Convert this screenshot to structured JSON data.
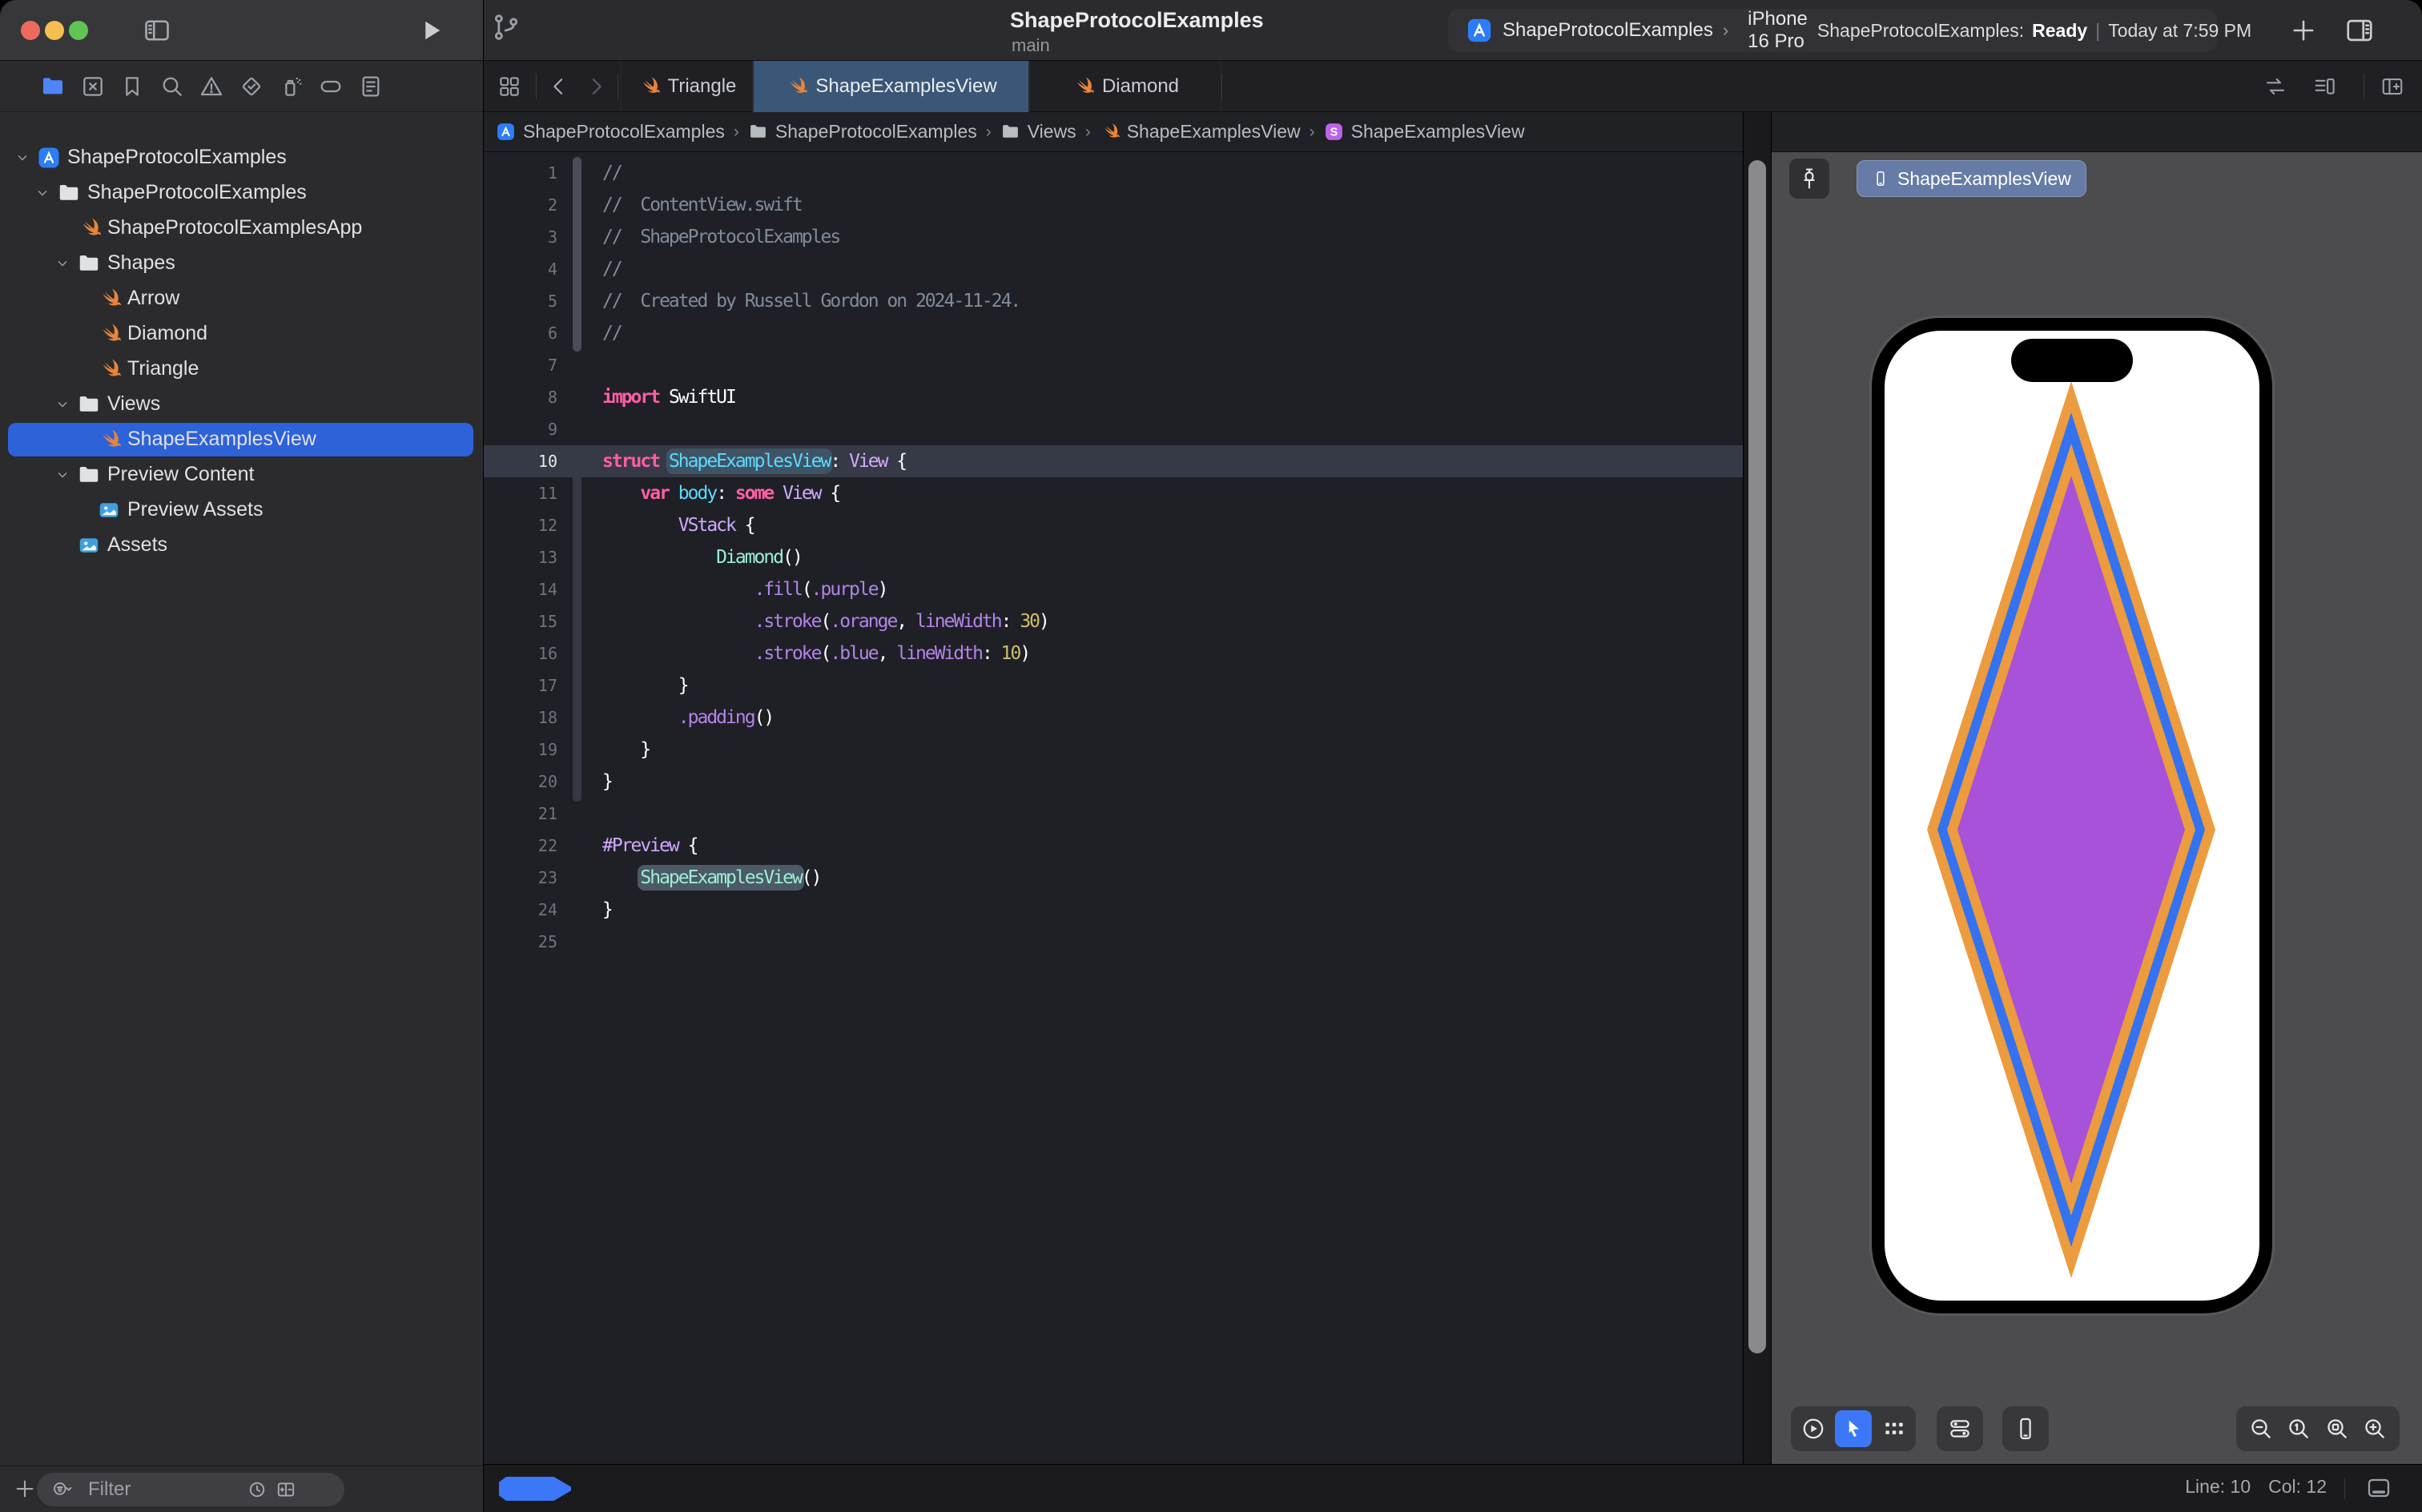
{
  "window": {
    "title": "ShapeProtocolExamples",
    "subtitle": "main"
  },
  "toolbar": {
    "scheme_app": "ShapeProtocolExamples",
    "sep": "›",
    "device": "iPhone 16 Pro",
    "status_app": "ShapeProtocolExamples:",
    "status_state": "Ready",
    "status_bar": "|",
    "status_time": "Today at 7:59 PM"
  },
  "tabs": [
    {
      "label": "Triangle",
      "icon": "swift",
      "active": false
    },
    {
      "label": "ShapeExamplesView",
      "icon": "swift",
      "active": true
    },
    {
      "label": "Diamond",
      "icon": "swift",
      "active": false
    }
  ],
  "breadcrumbs": [
    {
      "icon": "app",
      "label": "ShapeProtocolExamples"
    },
    {
      "icon": "folder",
      "label": "ShapeProtocolExamples"
    },
    {
      "icon": "folder",
      "label": "Views"
    },
    {
      "icon": "swift",
      "label": "ShapeExamplesView"
    },
    {
      "icon": "s-symbol",
      "label": "ShapeExamplesView"
    }
  ],
  "crumb_sep": "›",
  "sidebar": {
    "rail": [
      "folder",
      "grid-x",
      "bookmark",
      "search",
      "warning",
      "check-diamond",
      "spray",
      "tag",
      "report"
    ],
    "rail_active": 0,
    "tree": [
      {
        "label": "ShapeProtocolExamples",
        "icon": "app",
        "level": 0,
        "exp": true
      },
      {
        "label": "ShapeProtocolExamples",
        "icon": "folder",
        "level": 1,
        "exp": true
      },
      {
        "label": "ShapeProtocolExamplesApp",
        "icon": "swift",
        "level": 2
      },
      {
        "label": "Shapes",
        "icon": "folder",
        "level": 2,
        "exp": true
      },
      {
        "label": "Arrow",
        "icon": "swift",
        "level": 3
      },
      {
        "label": "Diamond",
        "icon": "swift",
        "level": 3
      },
      {
        "label": "Triangle",
        "icon": "swift",
        "level": 3
      },
      {
        "label": "Views",
        "icon": "folder",
        "level": 2,
        "exp": true
      },
      {
        "label": "ShapeExamplesView",
        "icon": "swift",
        "level": 3,
        "selected": true
      },
      {
        "label": "Preview Content",
        "icon": "folder",
        "level": 2,
        "exp": true
      },
      {
        "label": "Preview Assets",
        "icon": "photos",
        "level": 3
      },
      {
        "label": "Assets",
        "icon": "photos",
        "level": 2
      }
    ],
    "filter_placeholder": "Filter"
  },
  "editor": {
    "current_line": 10,
    "lines": [
      {
        "n": 1,
        "tok": [
          [
            "//",
            "c"
          ]
        ]
      },
      {
        "n": 2,
        "tok": [
          [
            "//  ContentView.swift",
            "c"
          ]
        ]
      },
      {
        "n": 3,
        "tok": [
          [
            "//  ShapeProtocolExamples",
            "c"
          ]
        ]
      },
      {
        "n": 4,
        "tok": [
          [
            "//",
            "c"
          ]
        ]
      },
      {
        "n": 5,
        "tok": [
          [
            "//  Created by Russell Gordon on 2024-11-24.",
            "c"
          ]
        ]
      },
      {
        "n": 6,
        "tok": [
          [
            "//",
            "c"
          ]
        ]
      },
      {
        "n": 7,
        "tok": []
      },
      {
        "n": 8,
        "tok": [
          [
            "import",
            "k"
          ],
          [
            " SwiftUI",
            "p"
          ]
        ]
      },
      {
        "n": 9,
        "tok": []
      },
      {
        "n": 10,
        "tok": [
          [
            "struct",
            "k"
          ],
          [
            " ",
            "p"
          ],
          [
            "ShapeExamplesView",
            "d hl1"
          ],
          [
            ": ",
            "p"
          ],
          [
            "View",
            "t"
          ],
          [
            " {",
            "p"
          ]
        ]
      },
      {
        "n": 11,
        "tok": [
          [
            "    ",
            "p"
          ],
          [
            "var",
            "k"
          ],
          [
            " ",
            "p"
          ],
          [
            "body",
            "d"
          ],
          [
            ": ",
            "p"
          ],
          [
            "some",
            "k"
          ],
          [
            " ",
            "p"
          ],
          [
            "View",
            "t"
          ],
          [
            " {",
            "p"
          ]
        ]
      },
      {
        "n": 12,
        "tok": [
          [
            "        ",
            "p"
          ],
          [
            "VStack",
            "t"
          ],
          [
            " {",
            "p"
          ]
        ]
      },
      {
        "n": 13,
        "tok": [
          [
            "            ",
            "p"
          ],
          [
            "Diamond",
            "g"
          ],
          [
            "()",
            "p"
          ]
        ]
      },
      {
        "n": 14,
        "tok": [
          [
            "                ",
            "p"
          ],
          [
            ".fill",
            "m"
          ],
          [
            "(",
            "p"
          ],
          [
            ".purple",
            "m"
          ],
          [
            ")",
            "p"
          ]
        ]
      },
      {
        "n": 15,
        "tok": [
          [
            "                ",
            "p"
          ],
          [
            ".stroke",
            "m"
          ],
          [
            "(",
            "p"
          ],
          [
            ".orange",
            "m"
          ],
          [
            ", ",
            "p"
          ],
          [
            "lineWidth",
            "m"
          ],
          [
            ": ",
            "p"
          ],
          [
            "30",
            "n"
          ],
          [
            ")",
            "p"
          ]
        ]
      },
      {
        "n": 16,
        "tok": [
          [
            "                ",
            "p"
          ],
          [
            ".stroke",
            "m"
          ],
          [
            "(",
            "p"
          ],
          [
            ".blue",
            "m"
          ],
          [
            ", ",
            "p"
          ],
          [
            "lineWidth",
            "m"
          ],
          [
            ": ",
            "p"
          ],
          [
            "10",
            "n"
          ],
          [
            ")",
            "p"
          ]
        ]
      },
      {
        "n": 17,
        "tok": [
          [
            "        }",
            "p"
          ]
        ]
      },
      {
        "n": 18,
        "tok": [
          [
            "        ",
            "p"
          ],
          [
            ".padding",
            "m"
          ],
          [
            "()",
            "p"
          ]
        ]
      },
      {
        "n": 19,
        "tok": [
          [
            "    }",
            "p"
          ]
        ]
      },
      {
        "n": 20,
        "tok": [
          [
            "}",
            "p"
          ]
        ]
      },
      {
        "n": 21,
        "tok": []
      },
      {
        "n": 22,
        "tok": [
          [
            "#Preview",
            "t"
          ],
          [
            " {",
            "p"
          ]
        ]
      },
      {
        "n": 23,
        "tok": [
          [
            "    ",
            "p"
          ],
          [
            "ShapeExamplesView",
            "g hl2"
          ],
          [
            "()",
            "p"
          ]
        ]
      },
      {
        "n": 24,
        "tok": [
          [
            "}",
            "p"
          ]
        ]
      },
      {
        "n": 25,
        "tok": []
      }
    ]
  },
  "preview": {
    "chip_label": "ShapeExamplesView",
    "toolbar_left": [
      "play-circle",
      "cursor",
      "grid-dots"
    ],
    "toolbar_left_active": 1,
    "device_buttons": [
      "toggles",
      "device"
    ],
    "zoom_buttons": [
      "zoom-out",
      "zoom-one",
      "zoom-fit",
      "zoom-in"
    ]
  },
  "statusbar": {
    "line": "Line: 10",
    "col": "Col: 12"
  },
  "colors": {
    "accent": "#2e62d9",
    "tab_selected": "#3b5777",
    "diamond_orange": "#ec9b3e",
    "diamond_blue": "#3472f0",
    "diamond_purple": "#a752d9",
    "chip": "#667ca6"
  }
}
